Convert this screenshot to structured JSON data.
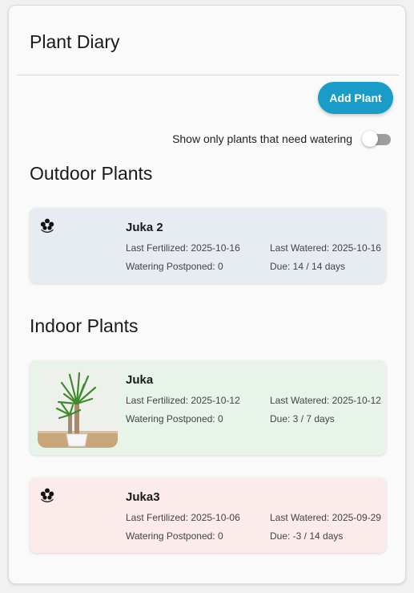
{
  "app": {
    "title": "Plant Diary",
    "add_button_label": "Add Plant",
    "filter_label": "Show only plants that need watering",
    "filter_enabled": false
  },
  "colors": {
    "accent": "#1a9cc8",
    "outdoor_card_bg": "#e6ecf2",
    "indoor_ok_bg": "#e8f4ea",
    "indoor_overdue_bg": "#fbebea"
  },
  "outdoor": {
    "title": "Outdoor Plants",
    "plants": [
      {
        "name": "Juka 2",
        "icon": "flower-icon",
        "last_fertilized": "Last Fertilized: 2025-10-16",
        "last_watered": "Last Watered: 2025-10-16",
        "postponed": "Watering Postponed: 0",
        "due": "Due: 14 / 14 days"
      }
    ]
  },
  "indoor": {
    "title": "Indoor Plants",
    "plants": [
      {
        "name": "Juka",
        "icon": "plant-photo",
        "last_fertilized": "Last Fertilized: 2025-10-12",
        "last_watered": "Last Watered: 2025-10-12",
        "postponed": "Watering Postponed: 0",
        "due": "Due: 3 / 7 days"
      },
      {
        "name": "Juka3",
        "icon": "flower-icon",
        "last_fertilized": "Last Fertilized: 2025-10-06",
        "last_watered": "Last Watered: 2025-09-29",
        "postponed": "Watering Postponed: 0",
        "due": "Due: -3 / 14 days"
      }
    ]
  }
}
